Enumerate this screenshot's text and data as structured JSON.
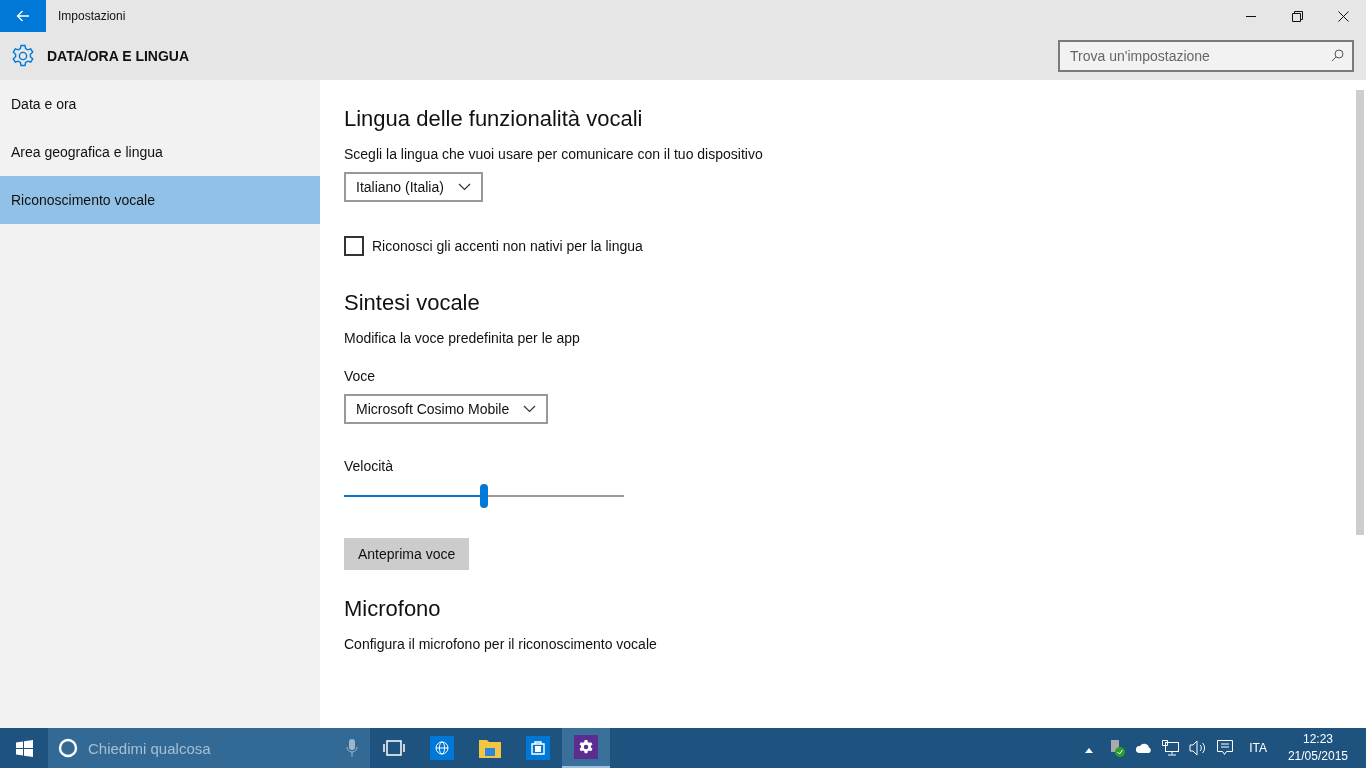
{
  "window": {
    "title": "Impostazioni"
  },
  "header": {
    "title": "DATA/ORA E LINGUA",
    "search": {
      "placeholder": "Trova un'impostazione"
    }
  },
  "sidebar": {
    "items": [
      {
        "label": "Data e ora",
        "selected": false
      },
      {
        "label": "Area geografica e lingua",
        "selected": false
      },
      {
        "label": "Riconoscimento vocale",
        "selected": true
      }
    ]
  },
  "content": [
    {
      "kind": "heading",
      "text": "Lingua delle funzionalità vocali"
    },
    {
      "kind": "text",
      "text": "Scegli la lingua che vuoi usare per comunicare con il tuo dispositivo"
    },
    {
      "kind": "dropdown",
      "value": "Italiano (Italia)"
    },
    {
      "kind": "checkbox",
      "label": "Riconosci gli accenti non nativi per la lingua",
      "checked": false
    },
    {
      "kind": "heading",
      "text": "Sintesi vocale"
    },
    {
      "kind": "text",
      "text": "Modifica la voce predefinita per le app"
    },
    {
      "kind": "label",
      "text": "Voce"
    },
    {
      "kind": "dropdown",
      "value": "Microsoft Cosimo Mobile"
    },
    {
      "kind": "label",
      "text": "Velocità"
    },
    {
      "kind": "slider",
      "level": 0.5
    },
    {
      "kind": "button",
      "label": "Anteprima voce"
    },
    {
      "kind": "heading",
      "text": "Microfono"
    },
    {
      "kind": "text",
      "text": "Configura il microfono per il riconoscimento vocale"
    }
  ],
  "taskbar": {
    "search": {
      "placeholder": "Chiedimi qualcosa"
    },
    "apps": [
      {
        "kind": "globe",
        "selected": false
      },
      {
        "kind": "folder",
        "selected": false
      },
      {
        "kind": "store",
        "selected": false
      },
      {
        "kind": "settings",
        "selected": true
      }
    ],
    "language": "ITA",
    "time": "12:23",
    "date": "21/05/2015"
  }
}
